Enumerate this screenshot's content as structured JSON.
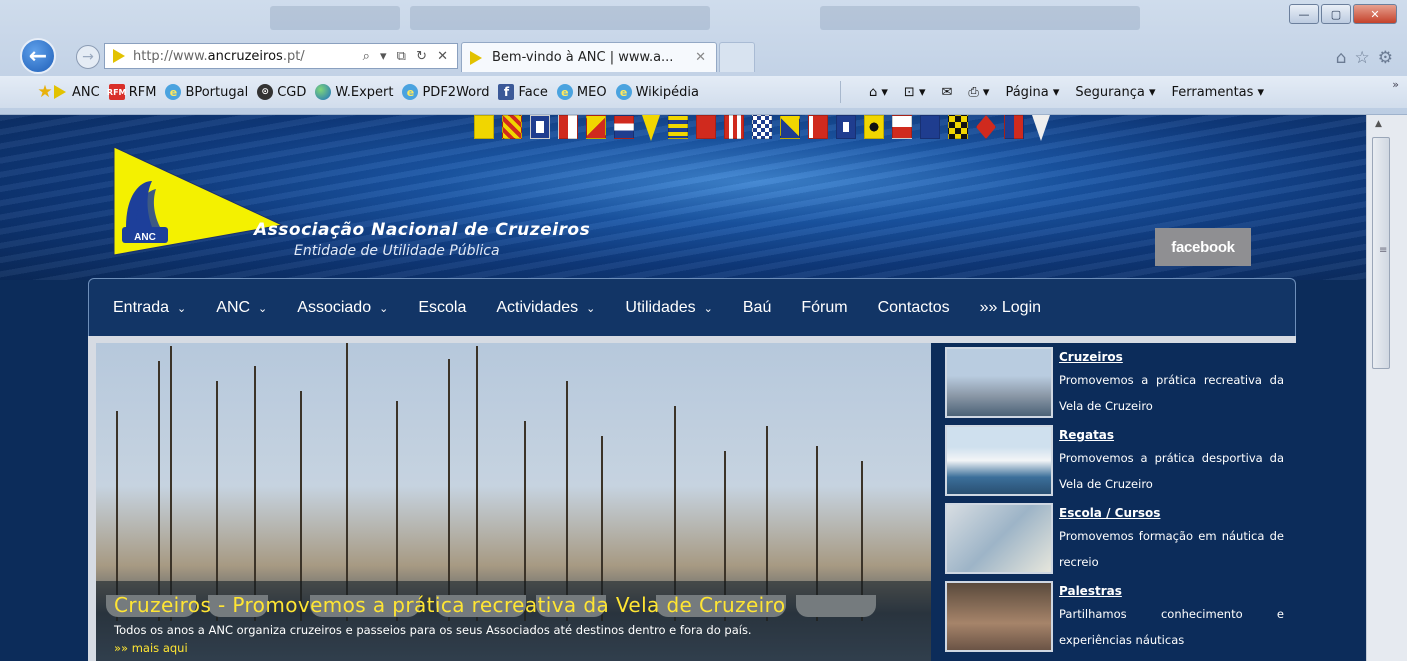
{
  "browser": {
    "address_url_prefix": "http://www.",
    "address_url_domain": "ancruzeiros",
    "address_url_suffix": ".pt/",
    "address_tools": "⌕ ▾ ⧉ ↻ ✕",
    "tab_title": "Bem-vindo à ANC | www.a...",
    "tab_close": "✕",
    "window_buttons": [
      "—",
      "▢",
      "✕"
    ],
    "nav_icons": [
      "⌂",
      "☆",
      "⚙"
    ],
    "favorites": [
      {
        "label": "ANC",
        "icon": "anc-flag-icon"
      },
      {
        "label": "RFM",
        "icon": "rfm-icon"
      },
      {
        "label": "BPortugal",
        "icon": "ie-page-icon"
      },
      {
        "label": "CGD",
        "icon": "cgd-icon"
      },
      {
        "label": "W.Expert",
        "icon": "globe-icon"
      },
      {
        "label": "PDF2Word",
        "icon": "ie-page-icon"
      },
      {
        "label": "Face",
        "icon": "facebook-icon"
      },
      {
        "label": "MEO",
        "icon": "ie-page-icon"
      },
      {
        "label": "Wikipédia",
        "icon": "ie-page-icon"
      }
    ],
    "command_bar": [
      "Página ▾",
      "Segurança ▾",
      "Ferramentas ▾"
    ],
    "command_icons": [
      "⌂ ▾",
      "⊡ ▾",
      "✉",
      "⎙ ▾"
    ],
    "overflow": "»"
  },
  "site": {
    "logo_text": "ANC",
    "title": "Associação Nacional de Cruzeiros",
    "subtitle": "Entidade de Utilidade Pública",
    "facebook_label": "facebook",
    "menu": [
      {
        "label": "Entrada",
        "dropdown": true
      },
      {
        "label": "ANC",
        "dropdown": true
      },
      {
        "label": "Associado",
        "dropdown": true
      },
      {
        "label": "Escola",
        "dropdown": false
      },
      {
        "label": "Actividades",
        "dropdown": true
      },
      {
        "label": "Utilidades",
        "dropdown": true
      },
      {
        "label": "Baú",
        "dropdown": false
      },
      {
        "label": "Fórum",
        "dropdown": false
      },
      {
        "label": "Contactos",
        "dropdown": false
      },
      {
        "label": "»» Login",
        "dropdown": false
      }
    ],
    "slide": {
      "title": "Cruzeiros - Promovemos a prática recreativa da Vela de Cruzeiro",
      "text": "Todos os anos a ANC organiza cruzeiros e passeios para os seus Associados até destinos dentro e fora do país.",
      "more": "»» mais aqui"
    },
    "side_items": [
      {
        "title": "Cruzeiros",
        "desc": "Promovemos a prática recreativa da Vela de Cruzeiro"
      },
      {
        "title": "Regatas",
        "desc": "Promovemos a prática desportiva da Vela de Cruzeiro"
      },
      {
        "title": "Escola / Cursos",
        "desc": "Promovemos formação em náutica de recreio"
      },
      {
        "title": "Palestras",
        "desc": "Partilhamos conhecimento e experiências náuticas"
      }
    ]
  },
  "colors": {
    "brand_navy": "#0c2c5a",
    "menu_bar": "#123566",
    "logo_yellow": "#f4f100",
    "caption_yellow": "#ffe533"
  }
}
